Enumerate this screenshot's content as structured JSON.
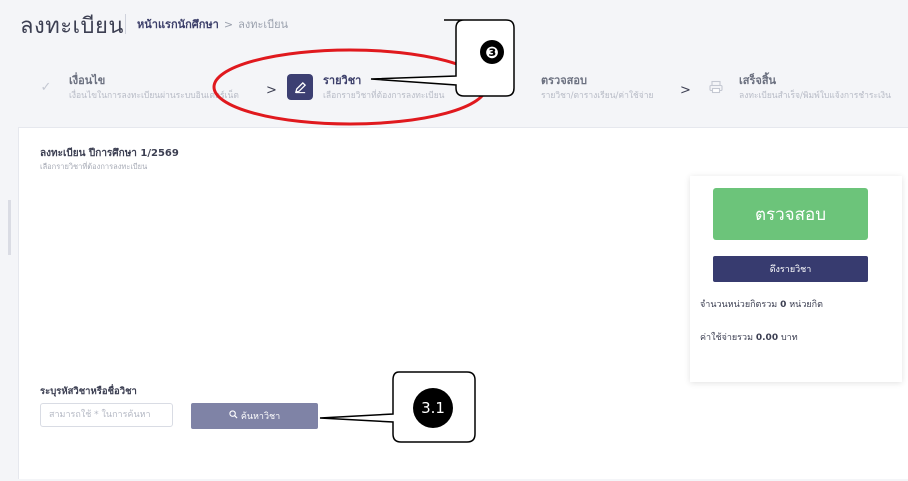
{
  "header": {
    "title": "ลงทะเบียน",
    "breadcrumb": {
      "home": "หน้าแรกนักศึกษา",
      "separator": ">",
      "current": "ลงทะเบียน"
    }
  },
  "steps": [
    {
      "label": "เงื่อนไข",
      "sub": "เงื่อนไขในการลงทะเบียนผ่านระบบอินเตอร์เน็ต",
      "icon": "check-icon",
      "active": false
    },
    {
      "label": "รายวิชา",
      "sub": "เลือกรายวิชาที่ต้องการลงทะเบียน",
      "icon": "pencil-icon",
      "active": true
    },
    {
      "label": "ตรวจสอบ",
      "sub": "รายวิชา/ตารางเรียน/ค่าใช้จ่าย",
      "icon": "",
      "active": false
    },
    {
      "label": "เสร็จสิ้น",
      "sub": "ลงทะเบียนสำเร็จ/พิมพ์ใบแจ้งการชำระเงิน",
      "icon": "printer-icon",
      "active": false
    }
  ],
  "step_chevron": ">",
  "registration": {
    "title": "ลงทะเบียน ปีการศึกษา 1/2569",
    "subtitle": "เลือกรายวิชาที่ต้องการลงทะเบียน"
  },
  "summary": {
    "check_button": "ตรวจสอบ",
    "pull_button": "ดึงรายวิชา",
    "credits_prefix": "จำนวนหน่วยกิตรวม",
    "credits_value": "0",
    "credits_unit": "หน่วยกิต",
    "cost_prefix": "ค่าใช้จ่ายรวม",
    "cost_value": "0.00",
    "cost_unit": "บาท"
  },
  "search": {
    "label": "ระบุรหัสวิชาหรือชื่อวิชา",
    "placeholder": "สามารถใช้ * ในการค้นหา",
    "button": "ค้นหาวิชา"
  },
  "annotations": {
    "callout_3": "❸",
    "callout_3_1": "3.1",
    "ellipse_color": "#e0191e"
  },
  "colors": {
    "accent": "#3c3f72",
    "check_green": "#6cc47a",
    "search_button": "#7f83a6"
  }
}
